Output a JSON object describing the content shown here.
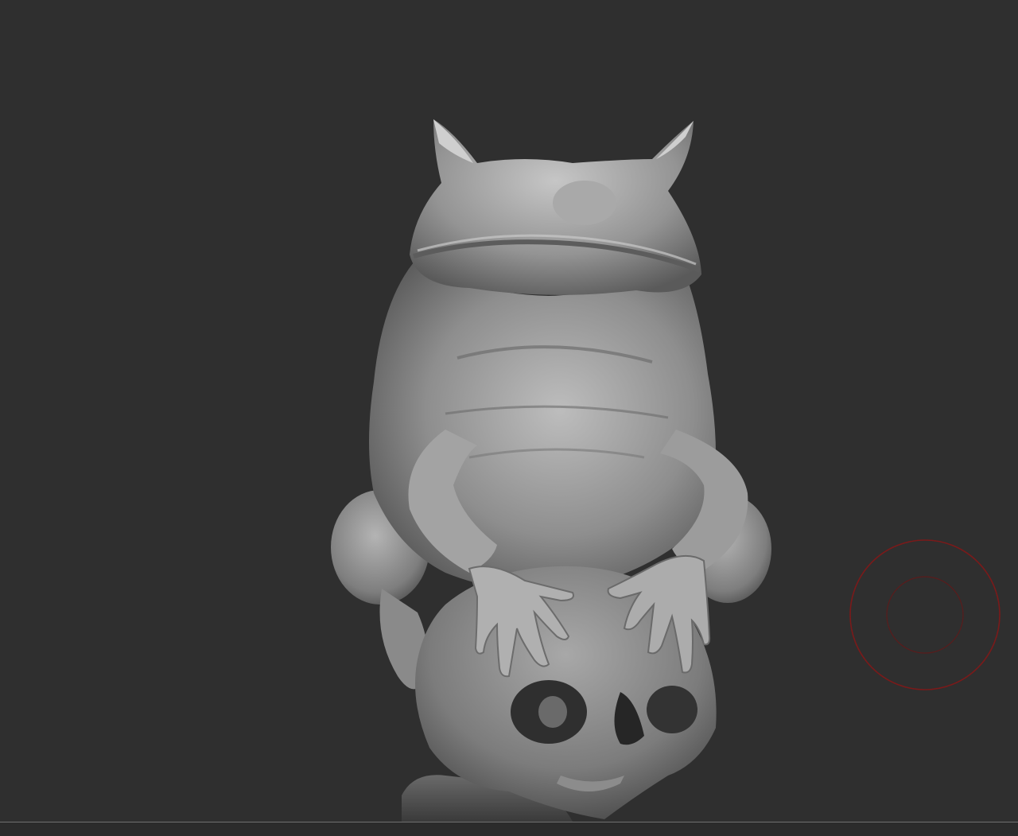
{
  "viewport": {
    "background_color": "#2f2f2f",
    "model": {
      "subject": "frog-on-skull-sculpt",
      "material_color": "#9a9a9a",
      "highlight_color": "#c4c4c4",
      "shadow_color": "#3c3c3c"
    },
    "brush_cursor": {
      "outer_color": "#7a1a1a",
      "inner_color": "#5a1c1c"
    },
    "floor_line_color": "#6f6f6f"
  }
}
